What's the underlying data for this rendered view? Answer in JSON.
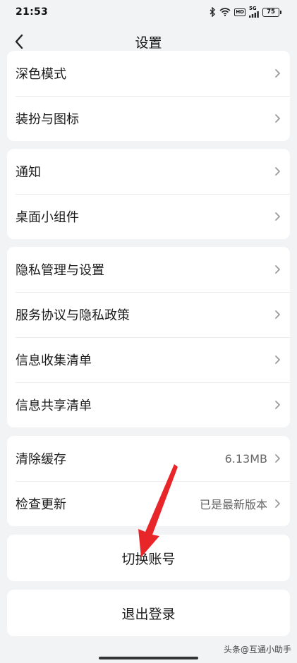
{
  "status_bar": {
    "time": "21:53",
    "network_badge": "HD",
    "signal_label": "5G",
    "battery": "75"
  },
  "header": {
    "title": "设置"
  },
  "groups": [
    {
      "items": [
        {
          "label": "深色模式"
        },
        {
          "label": "装扮与图标"
        }
      ]
    },
    {
      "items": [
        {
          "label": "通知"
        },
        {
          "label": "桌面小组件"
        }
      ]
    },
    {
      "items": [
        {
          "label": "隐私管理与设置"
        },
        {
          "label": "服务协议与隐私政策"
        },
        {
          "label": "信息收集清单"
        },
        {
          "label": "信息共享清单"
        }
      ]
    },
    {
      "items": [
        {
          "label": "清除缓存",
          "value": "6.13MB"
        },
        {
          "label": "检查更新",
          "value": "已是最新版本"
        }
      ]
    }
  ],
  "actions": {
    "switch_account": "切换账号",
    "logout": "退出登录"
  },
  "annotation": {
    "arrow_color": "#e8262a"
  },
  "watermark": "头条@互通小助手",
  "colors": {
    "background": "#f2f3f5",
    "card": "#ffffff",
    "chevron": "#9a9a9a"
  }
}
